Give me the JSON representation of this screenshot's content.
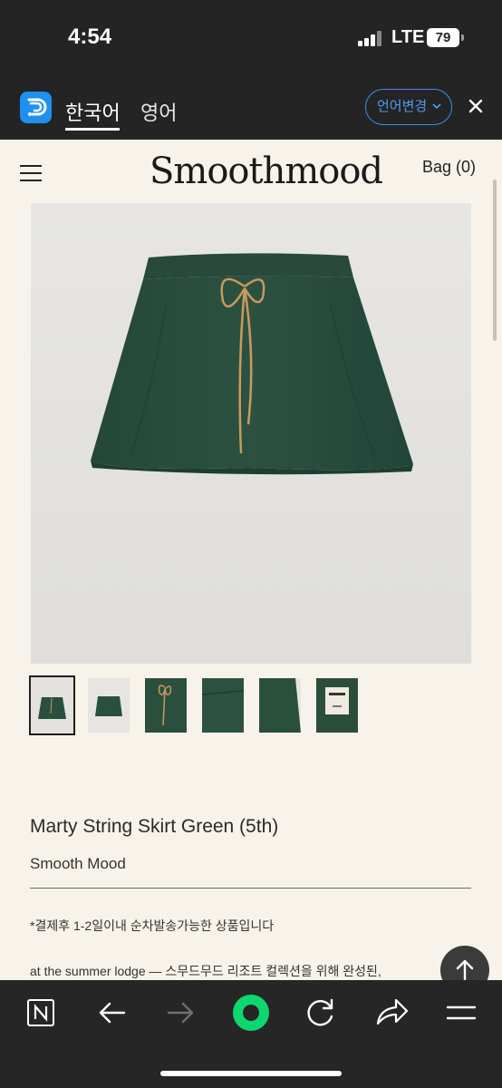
{
  "status_bar": {
    "time": "4:54",
    "network": "LTE",
    "battery": "79"
  },
  "translate_bar": {
    "active_language": "한국어",
    "other_language": "영어",
    "change_label": "언어변경",
    "accent_color": "#3a8ef2"
  },
  "site": {
    "logo": "Smoothmood",
    "bag": "Bag (0)"
  },
  "product": {
    "title": "Marty String Skirt Green (5th)",
    "brand": "Smooth Mood",
    "notice": "*결제후 1-2일이내 순차발송가능한 상품입니다",
    "description": "at the summer lodge — 스무드무드 리조트 컬렉션을 위해 완성된,",
    "thumbnail_count": 6,
    "selected_thumbnail": 1,
    "skirt_color": "#2b4f3d",
    "string_color": "#c99a5c"
  },
  "browser_bar": {
    "buttons": [
      "n-icon",
      "back-arrow-icon",
      "forward-arrow-icon",
      "green-home-icon",
      "refresh-icon",
      "share-icon",
      "menu-icon"
    ]
  }
}
